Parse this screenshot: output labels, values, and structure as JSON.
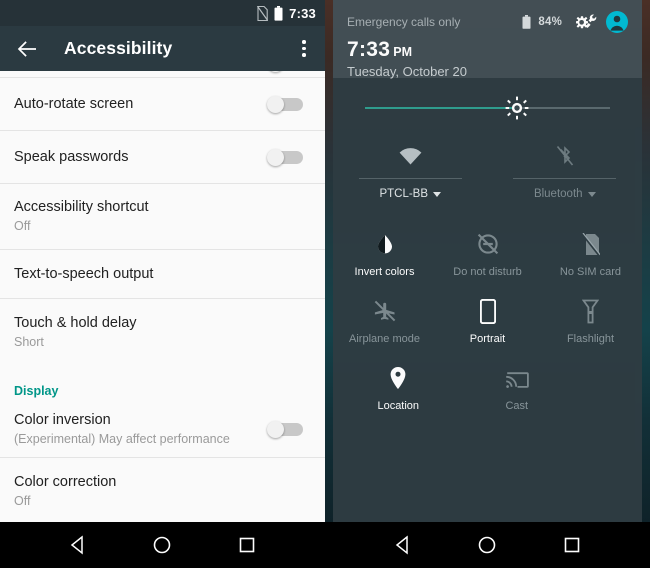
{
  "colors": {
    "accent_teal": "#009688",
    "slider_teal": "#2f9e8f",
    "avatar_cyan": "#00bcd4",
    "appbar": "#2b3a41",
    "statusbar": "#263238",
    "qs_panel": "#2e3c42",
    "qs_header": "#434f55",
    "list_bg": "#fafafa",
    "navbar": "#000000"
  },
  "left": {
    "statusbar": {
      "nosim_icon": "no-sim-card-icon",
      "battery_icon": "battery-icon",
      "time": "7:33"
    },
    "appbar": {
      "back_icon": "back-arrow-icon",
      "title": "Accessibility",
      "overflow_icon": "overflow-menu-icon"
    },
    "items": [
      {
        "id": "partial-top",
        "title": "",
        "subtitle": "",
        "control": "switch",
        "switch_state": "off",
        "partial": true
      },
      {
        "id": "auto-rotate-screen",
        "title": "Auto-rotate screen",
        "subtitle": "",
        "control": "switch",
        "switch_state": "off"
      },
      {
        "id": "speak-passwords",
        "title": "Speak passwords",
        "subtitle": "",
        "control": "switch",
        "switch_state": "off"
      },
      {
        "id": "accessibility-shortcut",
        "title": "Accessibility shortcut",
        "subtitle": "Off",
        "control": "none"
      },
      {
        "id": "text-to-speech-output",
        "title": "Text-to-speech output",
        "subtitle": "",
        "control": "none"
      },
      {
        "id": "touch-and-hold-delay",
        "title": "Touch & hold delay",
        "subtitle": "Short",
        "control": "none"
      }
    ],
    "section_header": "Display",
    "display_items": [
      {
        "id": "color-inversion",
        "title": "Color inversion",
        "subtitle": "(Experimental) May affect performance",
        "control": "switch",
        "switch_state": "off"
      },
      {
        "id": "color-correction",
        "title": "Color correction",
        "subtitle": "Off",
        "control": "none"
      }
    ],
    "navbar": {
      "back": "nav-back-icon",
      "home": "nav-home-icon",
      "recents": "nav-recents-icon"
    }
  },
  "right": {
    "header": {
      "carrier": "Emergency calls only",
      "battery_icon": "battery-icon",
      "battery_percent": "84%",
      "settings_icon": "settings-gear-wrench-icon",
      "avatar_icon": "user-avatar-icon",
      "time": "7:33",
      "ampm": "PM",
      "date": "Tuesday, October 20"
    },
    "brightness": {
      "label": "brightness-slider",
      "icon": "brightness-sun-icon",
      "value_percent": 62
    },
    "dual_tiles": [
      {
        "id": "wifi",
        "icon": "wifi-icon",
        "label": "PTCL-BB",
        "state": "on",
        "has_caret": true
      },
      {
        "id": "bluetooth",
        "icon": "bluetooth-disabled-icon",
        "label": "Bluetooth",
        "state": "off",
        "has_caret": true
      }
    ],
    "tiles": [
      [
        {
          "id": "invert-colors",
          "icon": "invert-colors-icon",
          "label": "Invert colors",
          "state": "on"
        },
        {
          "id": "do-not-disturb",
          "icon": "do-not-disturb-icon",
          "label": "Do not disturb",
          "state": "off"
        },
        {
          "id": "no-sim-card",
          "icon": "no-sim-card-icon",
          "label": "No SIM card",
          "state": "off"
        }
      ],
      [
        {
          "id": "airplane-mode",
          "icon": "airplane-mode-icon",
          "label": "Airplane mode",
          "state": "off"
        },
        {
          "id": "portrait",
          "icon": "screen-rotation-portrait-icon",
          "label": "Portrait",
          "state": "on"
        },
        {
          "id": "flashlight",
          "icon": "flashlight-icon",
          "label": "Flashlight",
          "state": "off"
        }
      ],
      [
        {
          "id": "location",
          "icon": "location-pin-icon",
          "label": "Location",
          "state": "on"
        },
        {
          "id": "cast",
          "icon": "cast-icon",
          "label": "Cast",
          "state": "off"
        }
      ]
    ],
    "navbar": {
      "back": "nav-back-icon",
      "home": "nav-home-icon",
      "recents": "nav-recents-icon"
    }
  }
}
